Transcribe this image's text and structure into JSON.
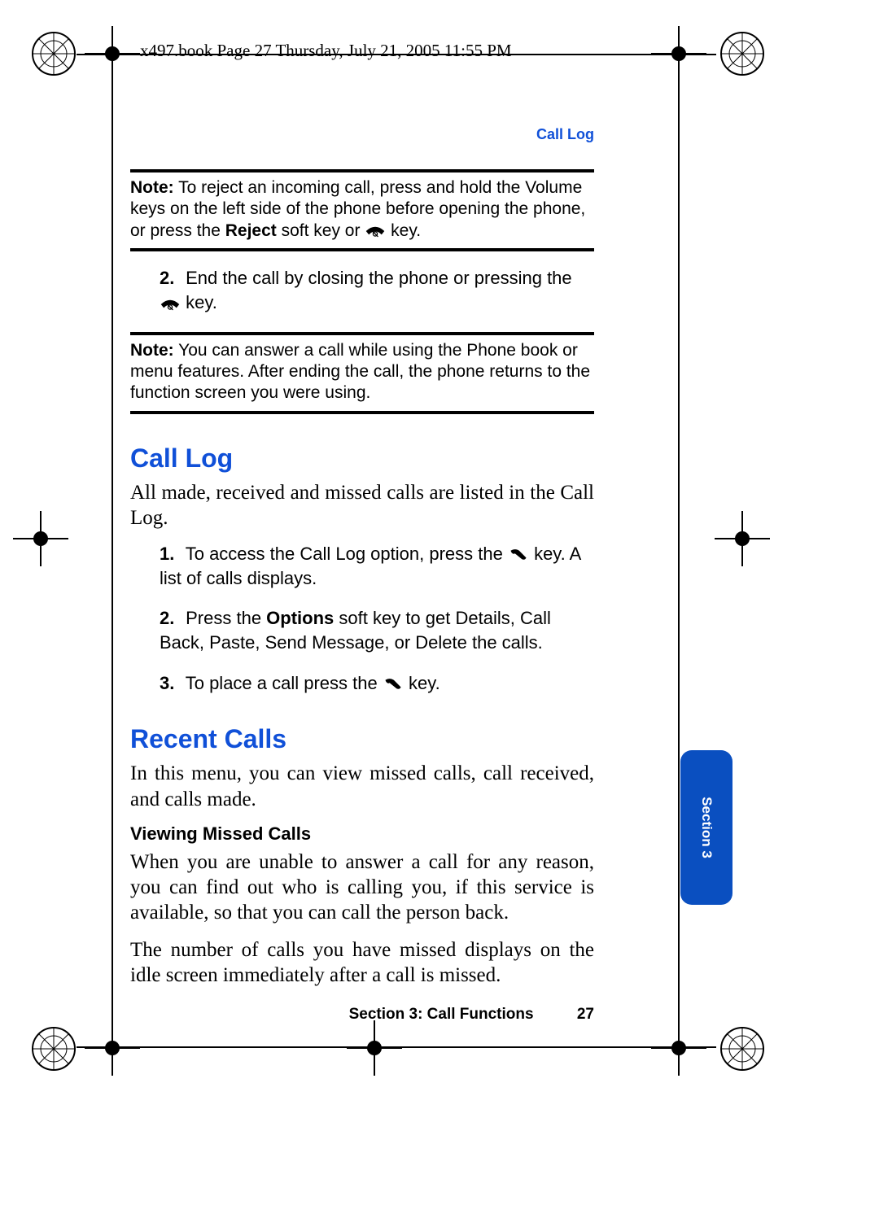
{
  "header": {
    "crop_text": "x497.book  Page 27  Thursday, July 21, 2005  11:55 PM"
  },
  "running_head": "Call Log",
  "note1": {
    "label": "Note:",
    "text_before_bold": " To reject an incoming call, press and hold the Volume keys on the left side of the phone before opening the phone, or press the ",
    "bold": "Reject",
    "text_after_bold": " soft key or ",
    "tail": " key."
  },
  "step_end": {
    "num": "2.",
    "text_before_icon": "End the call by closing the phone or pressing the ",
    "text_after_icon": " key."
  },
  "note2": {
    "label": "Note:",
    "text": " You can answer a call while using the Phone book or menu features. After ending the call, the phone returns to the function screen you were using."
  },
  "call_log": {
    "heading": "Call Log",
    "intro": "All made, received and missed calls are listed in the Call Log.",
    "steps": [
      {
        "num": "1.",
        "before": "To access the Call Log option, press the ",
        "after": " key. A list of calls displays."
      },
      {
        "num": "2.",
        "before": "Press the ",
        "bold": "Options",
        "after_bold": " soft key to get Details, Call Back, Paste, Send Message, or Delete the calls."
      },
      {
        "num": "3.",
        "before": "To place a call press the ",
        "after": " key."
      }
    ]
  },
  "recent": {
    "heading": "Recent Calls",
    "intro": "In this menu, you can view missed calls, call received, and calls made.",
    "sub": "Viewing Missed Calls",
    "p1": "When you are unable to answer a call for any reason, you can find out who is calling you, if this service is available, so that you can call the person back.",
    "p2": "The number of calls you have missed displays on the idle screen immediately after a call is missed."
  },
  "tab": "Section 3",
  "footer": {
    "section": "Section 3: Call Functions",
    "page": "27"
  }
}
